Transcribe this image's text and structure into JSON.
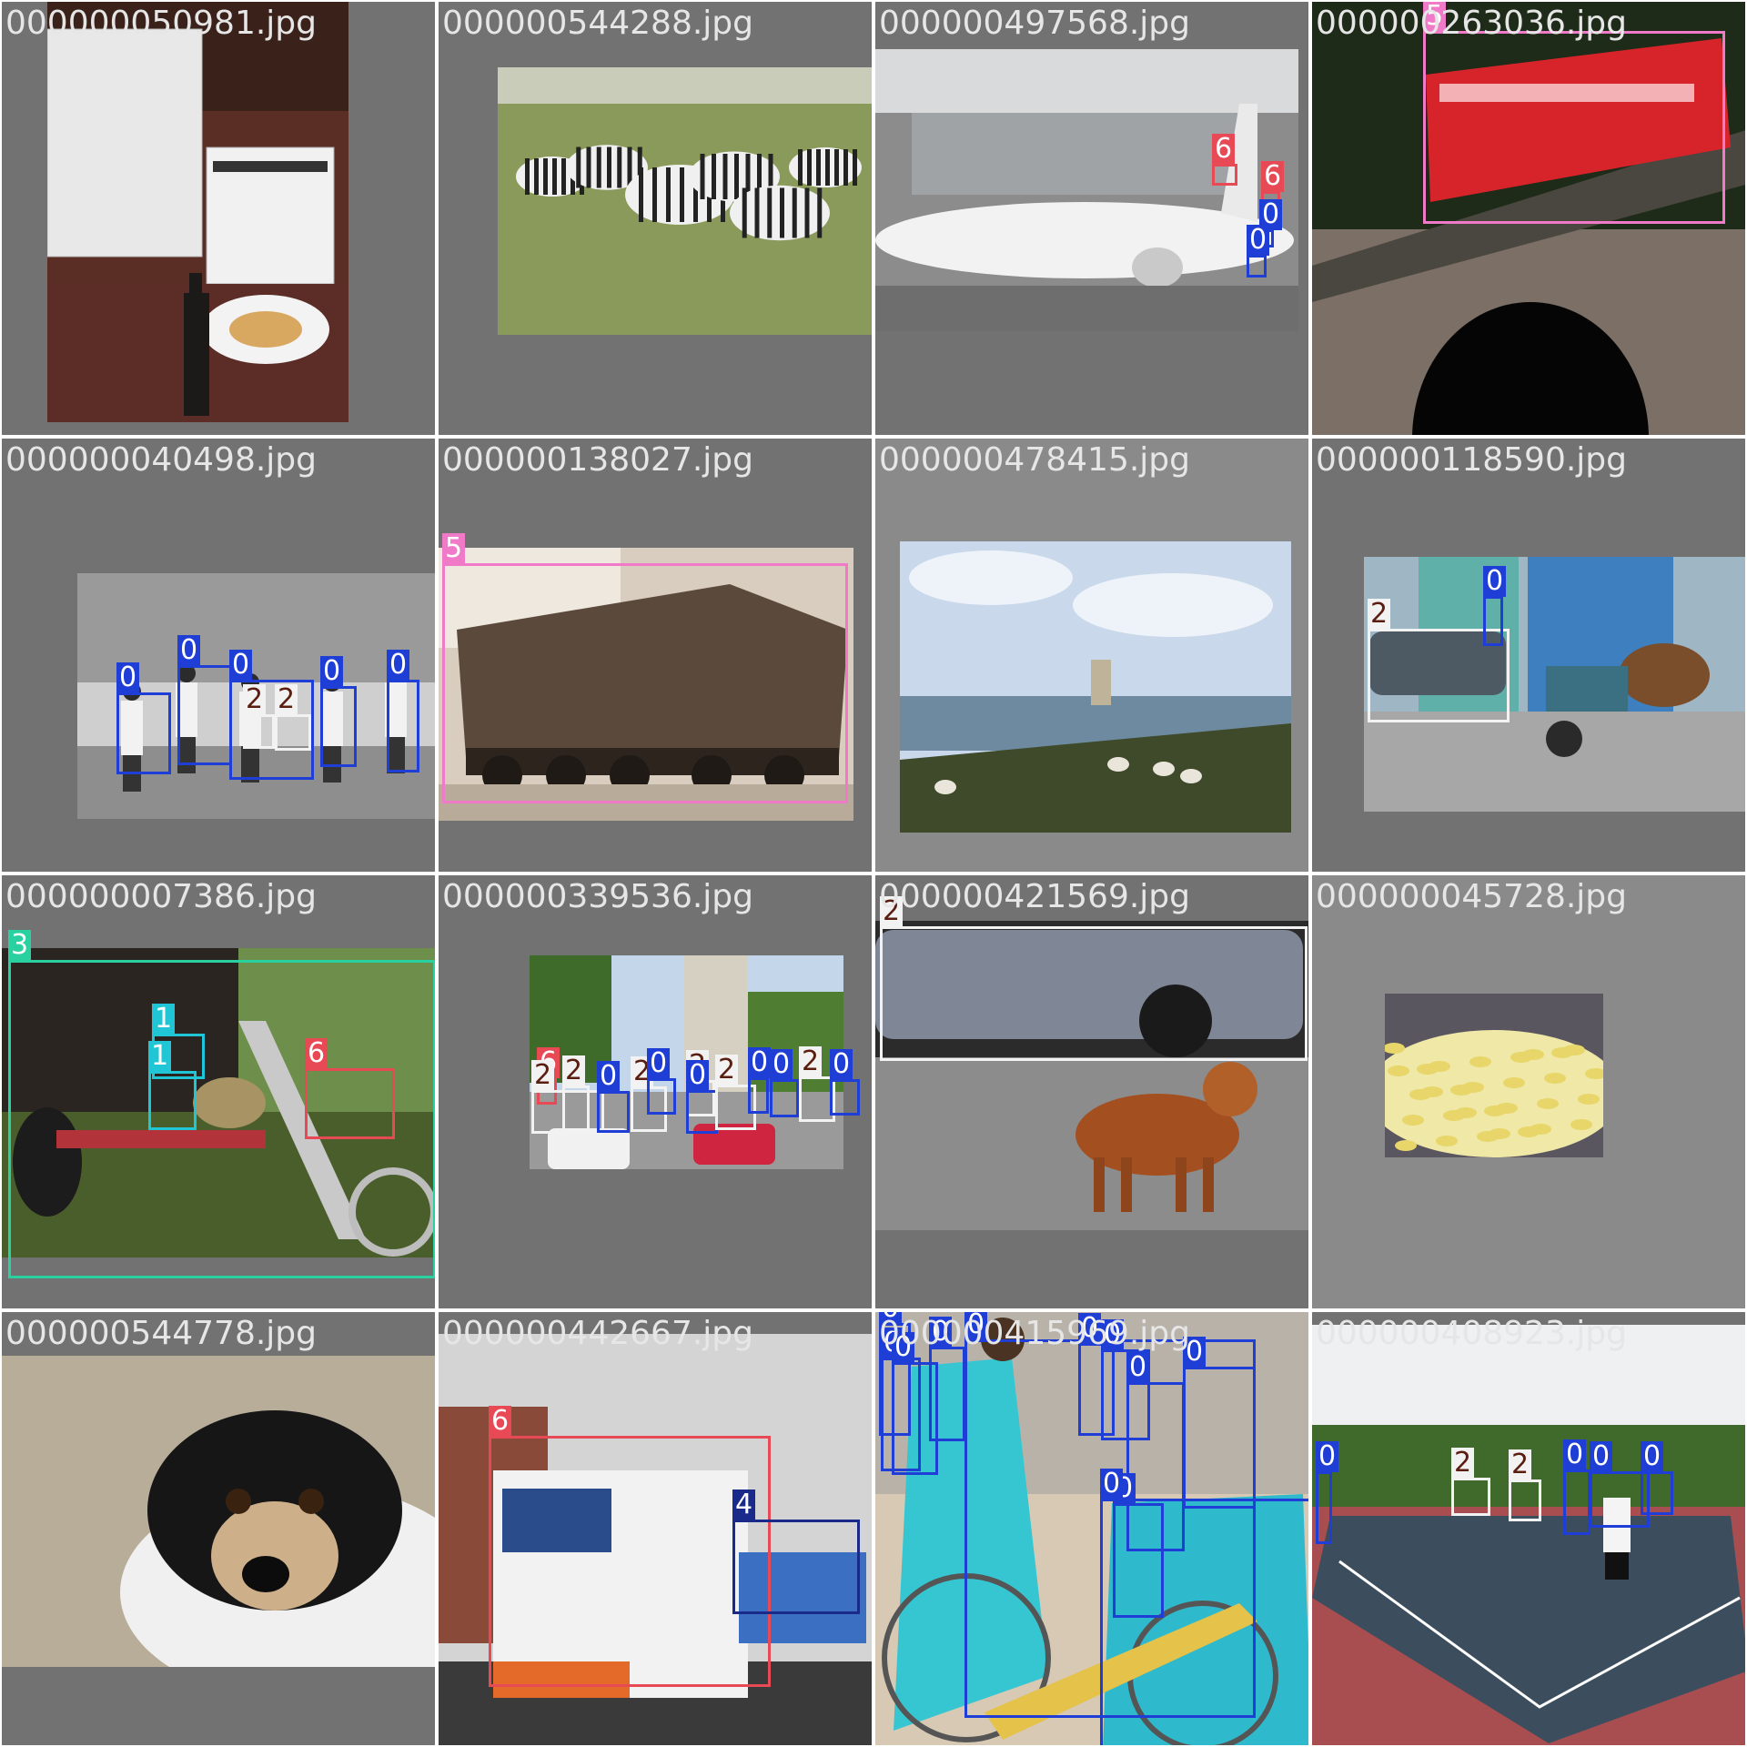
{
  "grid": {
    "columns": 4,
    "rows": 4
  },
  "palette": {
    "tile_background": "#727272",
    "tile_background_light": "#8a8a8a",
    "filename_text": "#e6e6e6"
  },
  "class_styles": {
    "0": {
      "color": "#1f3ed6",
      "text": "#ffffff"
    },
    "1": {
      "color": "#20c6d6",
      "text": "#ffffff"
    },
    "2": {
      "color": "#f2f2f2",
      "text": "#5a1e10"
    },
    "3": {
      "color": "#2ad1a0",
      "text": "#ffffff"
    },
    "4": {
      "color": "#1a2a8a",
      "text": "#ffffff"
    },
    "5": {
      "color": "#f07ac8",
      "text": "#ffffff"
    },
    "6": {
      "color": "#e84a55",
      "text": "#ffffff"
    }
  },
  "tiles": [
    {
      "filename": "000000050981.jpg",
      "scene": "kitchen-scene",
      "annotations": []
    },
    {
      "filename": "000000544288.jpg",
      "scene": "zebra-herd-scene",
      "annotations": []
    },
    {
      "filename": "000000497568.jpg",
      "scene": "airplane-scene",
      "annotations": [
        {
          "label": "6"
        },
        {
          "label": "6"
        },
        {
          "label": "0"
        },
        {
          "label": "0"
        }
      ]
    },
    {
      "filename": "000000263036.jpg",
      "scene": "train-bridge-scene",
      "annotations": [
        {
          "label": "5"
        }
      ]
    },
    {
      "filename": "000000040498.jpg",
      "scene": "dancers-scene",
      "annotations": [
        {
          "label": "0"
        },
        {
          "label": "0"
        },
        {
          "label": "0"
        },
        {
          "label": "0"
        },
        {
          "label": "0"
        },
        {
          "label": "2"
        },
        {
          "label": "2"
        }
      ]
    },
    {
      "filename": "000000138027.jpg",
      "scene": "locomotive-scene",
      "annotations": [
        {
          "label": "5"
        }
      ]
    },
    {
      "filename": "000000478415.jpg",
      "scene": "lake-sheep-scene",
      "annotations": []
    },
    {
      "filename": "000000118590.jpg",
      "scene": "street-horse-scene",
      "annotations": [
        {
          "label": "2"
        },
        {
          "label": "0"
        }
      ]
    },
    {
      "filename": "000000007386.jpg",
      "scene": "chopper-scene",
      "annotations": [
        {
          "label": "3"
        },
        {
          "label": "1"
        },
        {
          "label": "1"
        },
        {
          "label": "6"
        }
      ]
    },
    {
      "filename": "000000339536.jpg",
      "scene": "city-street-scene",
      "annotations": [
        {
          "label": "6"
        },
        {
          "label": "2"
        },
        {
          "label": "2"
        },
        {
          "label": "0"
        },
        {
          "label": "2"
        },
        {
          "label": "0"
        },
        {
          "label": "2"
        },
        {
          "label": "0"
        },
        {
          "label": "2"
        },
        {
          "label": "0"
        },
        {
          "label": "0"
        },
        {
          "label": "2"
        },
        {
          "label": "0"
        }
      ]
    },
    {
      "filename": "000000421569.jpg",
      "scene": "dog-car-scene",
      "annotations": [
        {
          "label": "2"
        }
      ]
    },
    {
      "filename": "000000045728.jpg",
      "scene": "noodles-scene",
      "annotations": []
    },
    {
      "filename": "000000544778.jpg",
      "scene": "puppy-scene",
      "annotations": []
    },
    {
      "filename": "000000442667.jpg",
      "scene": "tow-truck-scene",
      "annotations": [
        {
          "label": "6"
        },
        {
          "label": "4"
        }
      ]
    },
    {
      "filename": "000000415969.jpg",
      "scene": "bicycle-crowd-scene",
      "annotations": [
        {
          "label": "0"
        },
        {
          "label": "0"
        },
        {
          "label": "0"
        },
        {
          "label": "0"
        },
        {
          "label": "0"
        },
        {
          "label": "0"
        },
        {
          "label": "0"
        },
        {
          "label": "0"
        },
        {
          "label": "0"
        },
        {
          "label": "0"
        },
        {
          "label": "0"
        }
      ]
    },
    {
      "filename": "000000408923.jpg",
      "scene": "tennis-court-scene",
      "annotations": [
        {
          "label": "0"
        },
        {
          "label": "2"
        },
        {
          "label": "2"
        },
        {
          "label": "0"
        },
        {
          "label": "0"
        },
        {
          "label": "0"
        }
      ]
    }
  ]
}
